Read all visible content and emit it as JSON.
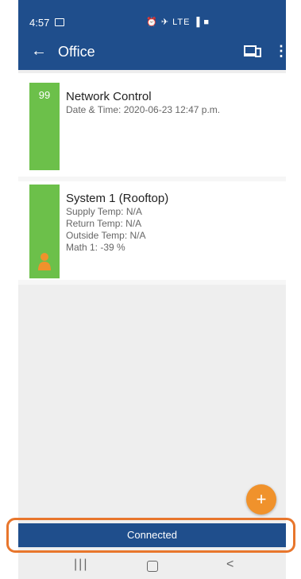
{
  "status_bar": {
    "time": "4:57",
    "icons_text": "⏰ ✈ LTE ▐ ■"
  },
  "app_bar": {
    "back_icon": "arrow-left-icon",
    "title": "Office",
    "devices_icon": "devices-icon",
    "more_icon": "more-vert-icon"
  },
  "cards": [
    {
      "badge": "99",
      "color": "#6cc04a",
      "title": "Network Control",
      "lines": [
        "Date & Time: 2020-06-23 12:47 p.m."
      ]
    },
    {
      "color": "#6cc04a",
      "icon": "person-icon",
      "icon_color": "#f0922c",
      "title": "System 1 (Rooftop)",
      "lines": [
        "Supply Temp: N/A",
        "Return Temp: N/A",
        "Outside Temp: N/A",
        "Math 1: -39 %"
      ]
    }
  ],
  "fab": {
    "label": "+",
    "color": "#f0922c"
  },
  "connection_status": "Connected",
  "nav_bar": {
    "recents": "|||",
    "home_icon": "home-icon",
    "back": "<"
  },
  "colors": {
    "primary": "#1f4e8c",
    "accent": "#f0922c",
    "highlight_frame": "#e8762c"
  }
}
